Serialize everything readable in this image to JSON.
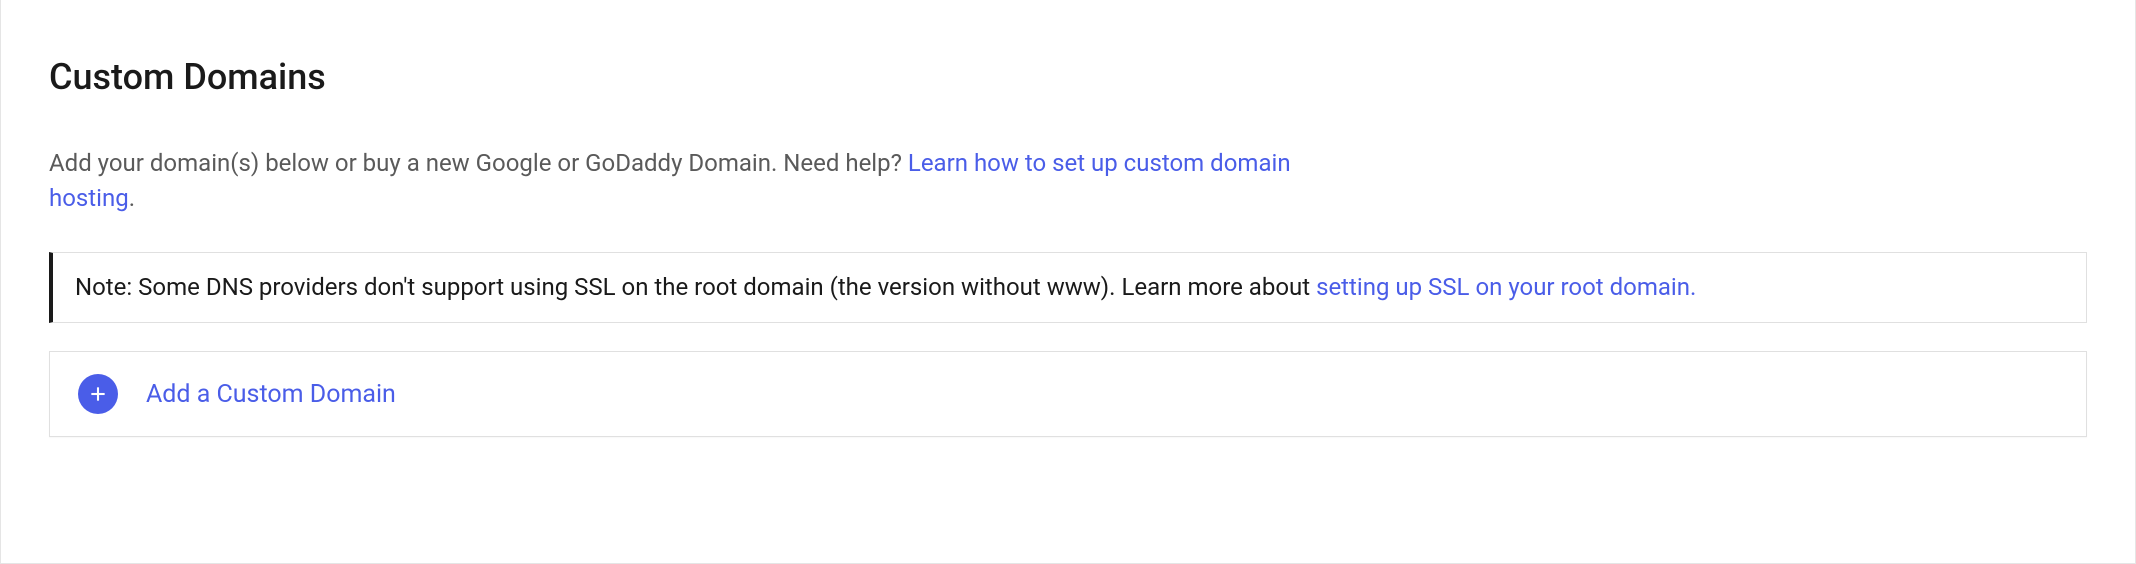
{
  "heading": "Custom Domains",
  "description": {
    "prefix": "Add your domain(s) below or buy a new Google or GoDaddy Domain. Need help? ",
    "link": "Learn how to set up custom domain hosting",
    "suffix": "."
  },
  "note": {
    "prefix": "Note: Some DNS providers don't support using SSL on the root domain (the version without www). Learn more about ",
    "link": "setting up SSL on your root domain.",
    "suffix": ""
  },
  "add_button": {
    "label": "Add a Custom Domain"
  }
}
